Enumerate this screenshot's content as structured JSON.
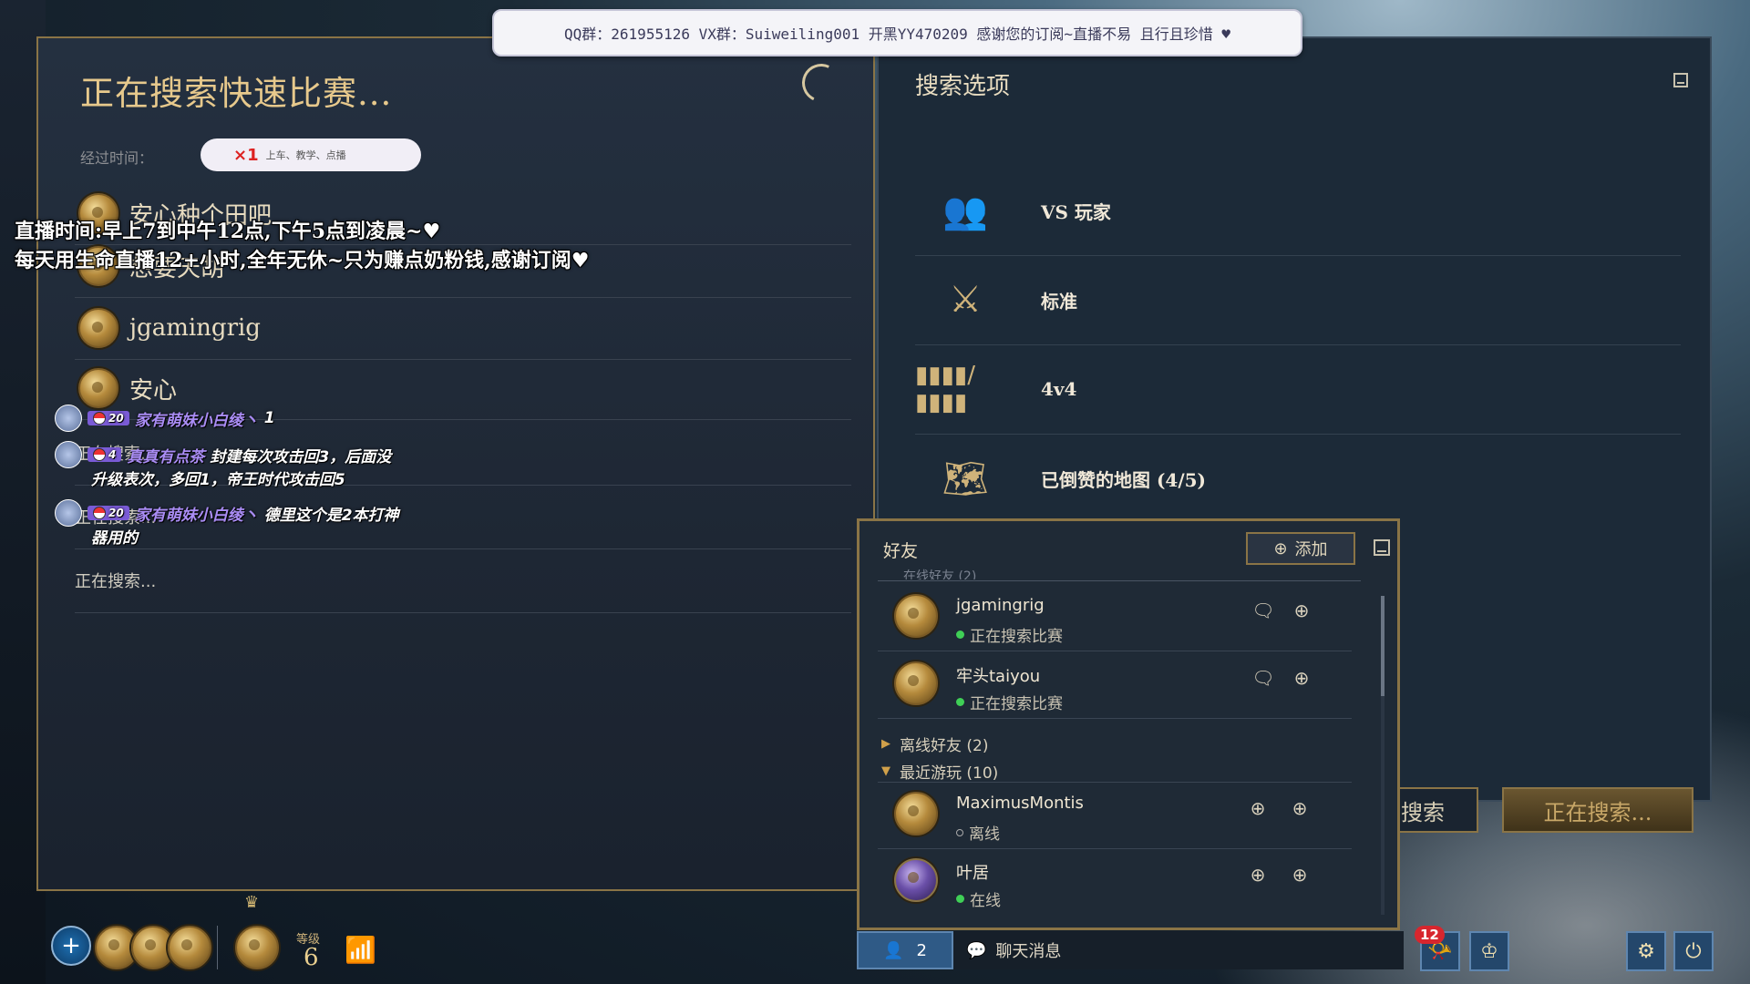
{
  "banner": {
    "text": "QQ群：261955126 VX群：Suiweiling001 开黑YY470209 感谢您的订阅~直播不易 且行且珍惜 ♥"
  },
  "left": {
    "title": "正在搜索快速比赛...",
    "elapsed_label": "经过时间：",
    "sticker": {
      "count": "×1",
      "tag": "上车、教学、点播"
    },
    "players": [
      "安心种个田吧",
      "想要天胡",
      "jgamingrig"
    ],
    "partial_player": "安心",
    "searching": [
      "正在搜索...",
      "正在搜索...",
      "正在搜索..."
    ]
  },
  "overlay": {
    "line1": "直播时间:早上7到中午12点,下午5点到凌晨~♥",
    "line2": "每天用生命直播12+小时,全年无休~只为赚点奶粉钱,感谢订阅♥"
  },
  "chat": [
    {
      "level": "20",
      "user": "家有萌妹小白绫丶",
      "msg": "1"
    },
    {
      "level": "4",
      "user": "真真有点茶",
      "msg": "封建每次攻击回3，后面没升级表次，多回1，帝王时代攻击回5"
    },
    {
      "level": "20",
      "user": "家有萌妹小白绫丶",
      "msg": "德里这个是2本打神器用的"
    }
  ],
  "chat_wrap": {
    "line2": "升级表次，多回1，帝王时代攻击回5",
    "line3": "器用的"
  },
  "right": {
    "title": "搜索选项",
    "options": [
      {
        "icon": "players-icon",
        "label": "VS 玩家"
      },
      {
        "icon": "crossed-swords-icon",
        "label": "标准"
      },
      {
        "icon": "team-size-icon",
        "label": "4v4"
      },
      {
        "icon": "map-icon",
        "label": "已倒赞的地图 (4/5)"
      }
    ],
    "btn_search": "搜索",
    "btn_searching": "正在搜索..."
  },
  "friends": {
    "title": "好友",
    "add_label": "添加",
    "online_header": "在线好友 (2)",
    "online": [
      {
        "name": "jgamingrig",
        "status": "正在搜索比赛"
      },
      {
        "name": "牢头taiyou",
        "status": "正在搜索比赛"
      }
    ],
    "offline_group": "离线好友 (2)",
    "recent_group": "最近游玩 (10)",
    "recent": [
      {
        "name": "MaximusMontis",
        "status": "离线"
      },
      {
        "name": "叶居",
        "status": "在线"
      }
    ]
  },
  "bottom": {
    "level_label": "等级",
    "level": "6",
    "online_count": "2",
    "chat_label": "聊天消息",
    "notif_count": "12"
  },
  "colors": {
    "gold": "#8a7446",
    "accent_blue": "#2f5a86",
    "online_green": "#3fcf56"
  }
}
